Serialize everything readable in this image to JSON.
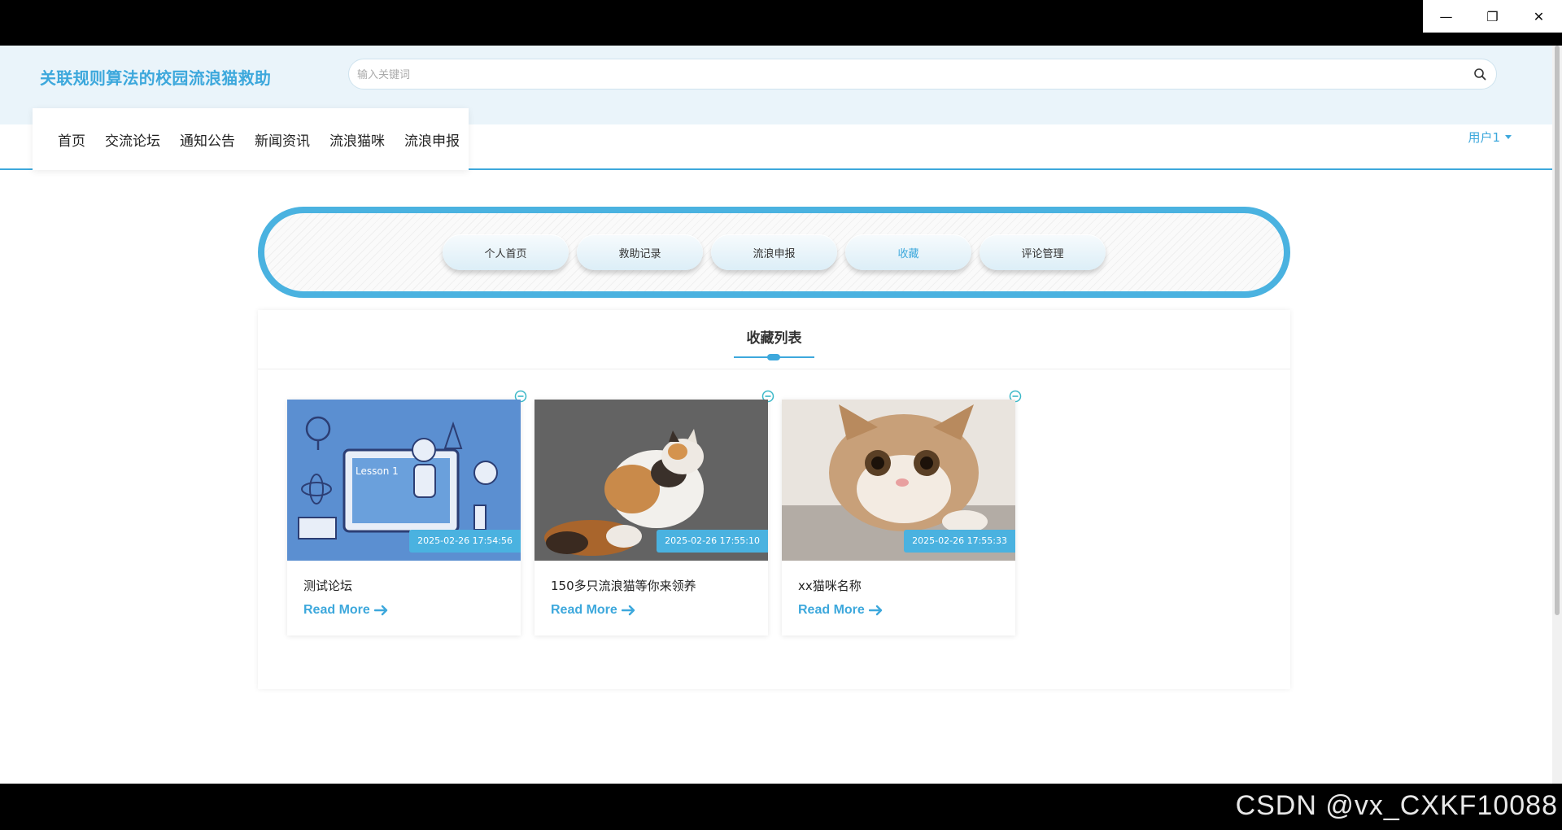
{
  "window": {
    "minimize": "—",
    "restore": "❐",
    "close": "✕"
  },
  "header": {
    "site_title": "关联规则算法的校园流浪猫救助"
  },
  "search": {
    "placeholder": "输入关键词"
  },
  "nav": {
    "items": [
      "首页",
      "交流论坛",
      "通知公告",
      "新闻资讯",
      "流浪猫咪",
      "流浪申报"
    ]
  },
  "user": {
    "name": "用户1"
  },
  "tabs": {
    "items": [
      "个人首页",
      "救助记录",
      "流浪申报",
      "收藏",
      "评论管理"
    ],
    "active": "收藏"
  },
  "panel": {
    "title": "收藏列表"
  },
  "cards": [
    {
      "title": "测试论坛",
      "date": "2025-02-26 17:54:56",
      "link": "Read More"
    },
    {
      "title": "150多只流浪猫等你来领养",
      "date": "2025-02-26 17:55:10",
      "link": "Read More"
    },
    {
      "title": "xx猫咪名称",
      "date": "2025-02-26 17:55:33",
      "link": "Read More"
    }
  ],
  "watermark": "CSDN @vx_CXKF10088",
  "colors": {
    "accent": "#3da8dc",
    "header_bg": "#eaf4fa",
    "frame": "#4ab2e0"
  },
  "icons": {
    "search": "search-icon",
    "remove": "minus-circle-icon",
    "arrow": "arrow-right-icon"
  },
  "illustration": {
    "lesson_label": "Lesson 1"
  }
}
